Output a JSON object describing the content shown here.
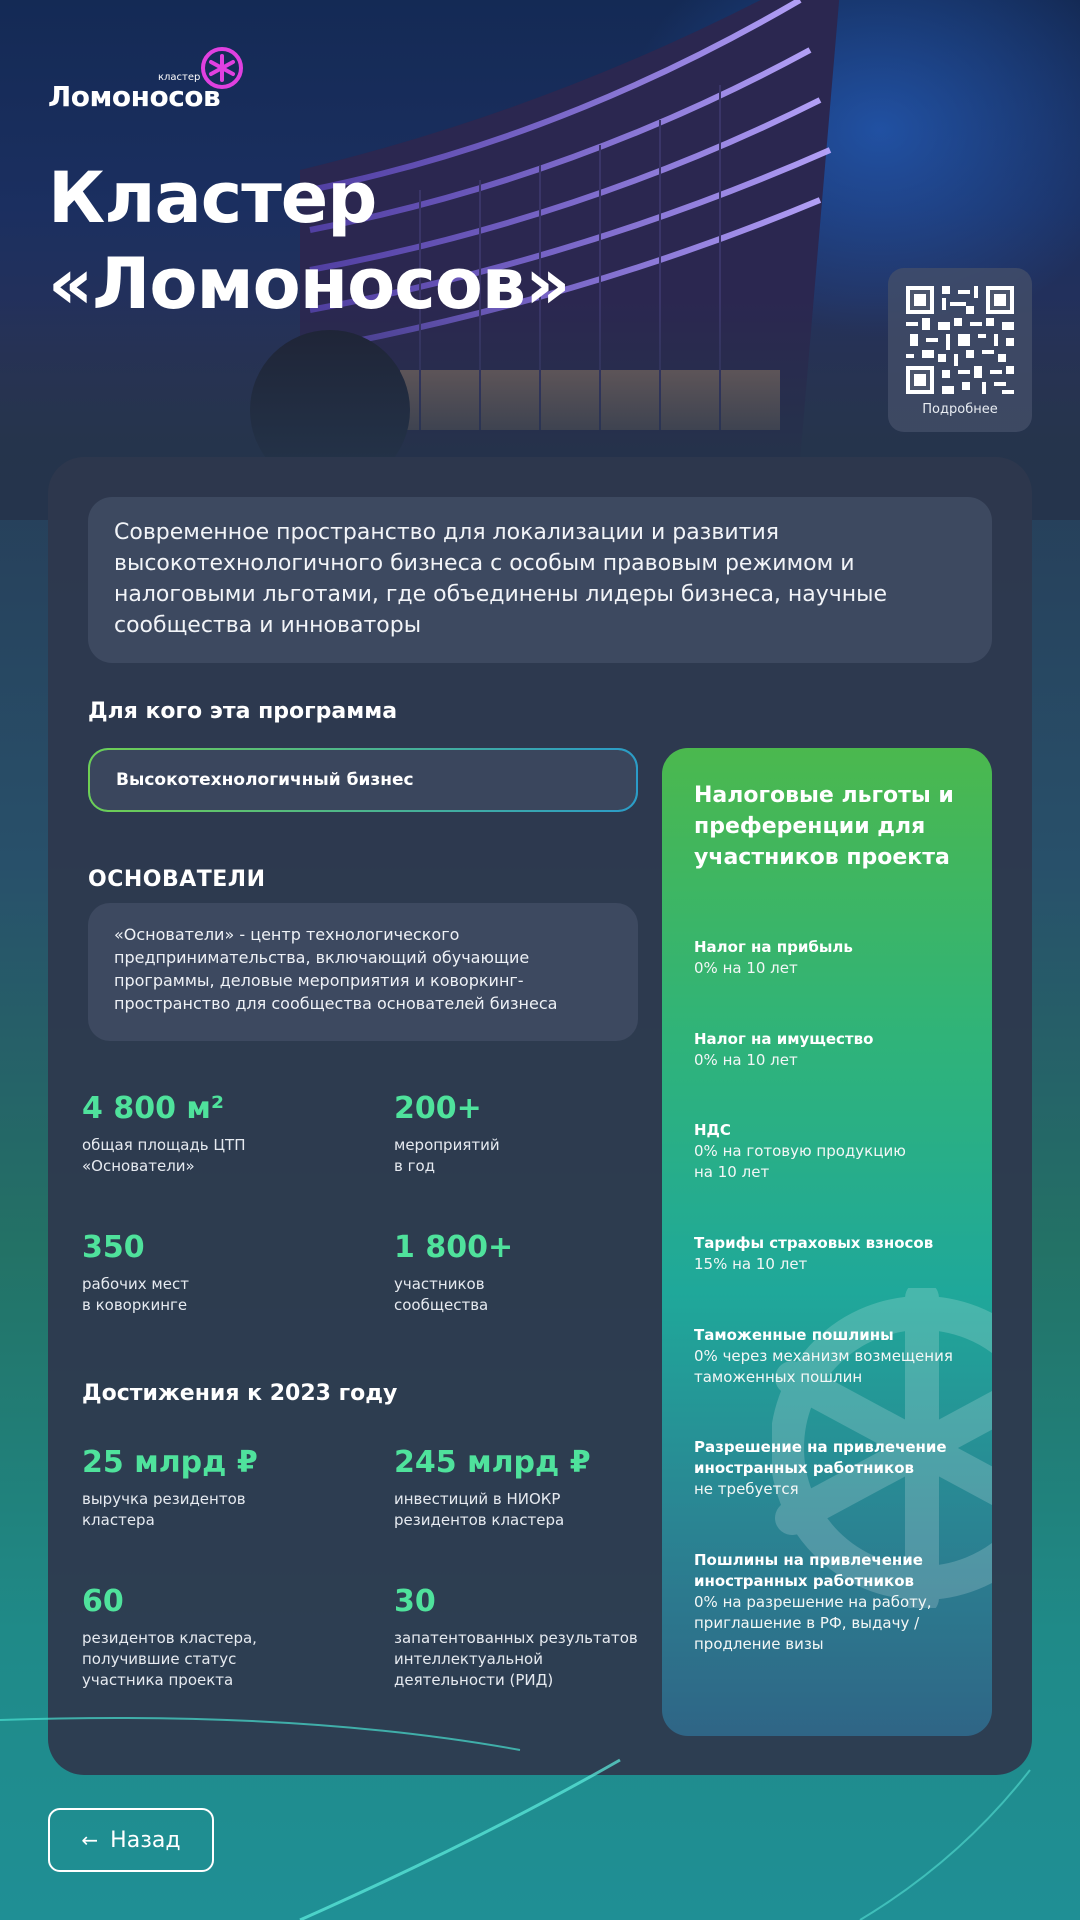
{
  "header": {
    "logo_small": "кластер",
    "logo_text": "Ломоносов",
    "title_line1": "Кластер",
    "title_line2": "«Ломоносов»",
    "qr_label": "Подробнее"
  },
  "intro": "Современное пространство для локализации и развития высокотехнологичного бизнеса с особым правовым режимом и налоговыми льготами, где объединены лидеры бизнеса, научные сообщества и инноваторы",
  "program": {
    "heading": "Для кого эта программа",
    "audience": "Высокотехнологичный бизнес"
  },
  "founders": {
    "heading": "ОСНОВАТЕЛИ",
    "text": "«Основатели» - центр технологического предпринимательства, включающий обучающие программы, деловые мероприятия и коворкинг-пространство для сообщества основателей бизнеса"
  },
  "stats": [
    {
      "value": "4 800 м²",
      "line1": "общая площадь ЦТП",
      "line2": "«Основатели»"
    },
    {
      "value": "200+",
      "line1": "мероприятий",
      "line2": "в год"
    },
    {
      "value": "350",
      "line1": "рабочих мест",
      "line2": "в коворкинге"
    },
    {
      "value": "1 800+",
      "line1": "участников",
      "line2": "сообщества"
    }
  ],
  "achievements": {
    "heading": "Достижения к 2023 году",
    "items": [
      {
        "value": "25 млрд ₽",
        "line1": "выручка резидентов",
        "line2": "кластера",
        "line3": ""
      },
      {
        "value": "245 млрд ₽",
        "line1": "инвестиций в НИОКР",
        "line2": "резидентов кластера",
        "line3": ""
      },
      {
        "value": "60",
        "line1": "резидентов кластера,",
        "line2": "получившие статус",
        "line3": "участника проекта"
      },
      {
        "value": "30",
        "line1": "запатентованных результатов",
        "line2": "интеллектуальной",
        "line3": "деятельности (РИД)"
      }
    ]
  },
  "benefits": {
    "title": "Налоговые льготы и преференции для участников проекта",
    "items": [
      {
        "heading": "Налог на прибыль",
        "text": "0% на 10 лет"
      },
      {
        "heading": "Налог на имущество",
        "text": "0% на 10 лет"
      },
      {
        "heading": "НДС",
        "text": "0% на готовую продукцию на 10 лет"
      },
      {
        "heading": "Тарифы страховых взносов",
        "text": "15% на 10 лет"
      },
      {
        "heading": "Таможенные пошлины",
        "text": "0% через механизм возмещения таможенных пошлин"
      },
      {
        "heading": "Разрешение на привлечение иностранных работников",
        "text": "не требуется"
      },
      {
        "heading": "Пошлины на привлечение иностранных работников",
        "text": "0% на разрешение на работу, приглашение в РФ, выдачу / продление визы"
      }
    ]
  },
  "footer": {
    "back_label": "Назад"
  },
  "colors": {
    "accent_green": "#4fe29c",
    "brand_magenta": "#e040e0"
  }
}
